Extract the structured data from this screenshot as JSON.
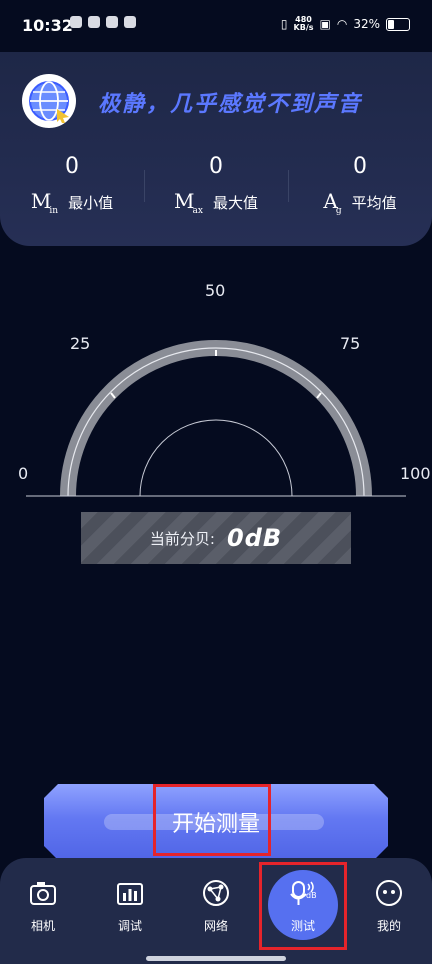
{
  "status_bar": {
    "time": "10:32",
    "net_speed_top": "480",
    "net_speed_bottom": "KB/s",
    "battery": "32%"
  },
  "header": {
    "status_text": "极静，几乎感觉不到声音",
    "stats": [
      {
        "icon_main": "M",
        "icon_sub": "in",
        "value": "0",
        "label": "最小值"
      },
      {
        "icon_main": "M",
        "icon_sub": "ax",
        "value": "0",
        "label": "最大值"
      },
      {
        "icon_main": "A",
        "icon_sub": "g",
        "value": "0",
        "label": "平均值"
      }
    ]
  },
  "gauge": {
    "labels": [
      "0",
      "25",
      "50",
      "75",
      "100"
    ],
    "current_level": 0
  },
  "readout": {
    "label": "当前分贝:",
    "value": "0dB"
  },
  "start_button": {
    "label": "开始测量"
  },
  "nav": {
    "items": [
      {
        "label": "相机",
        "icon": "camera-icon"
      },
      {
        "label": "调试",
        "icon": "chart-icon"
      },
      {
        "label": "网络",
        "icon": "network-icon"
      },
      {
        "label": "测试",
        "icon": "mic-db-icon",
        "active": true
      },
      {
        "label": "我的",
        "icon": "face-icon"
      }
    ]
  },
  "colors": {
    "accent": "#5670f0",
    "title": "#5b78ff",
    "highlight_box": "#e5242b"
  }
}
